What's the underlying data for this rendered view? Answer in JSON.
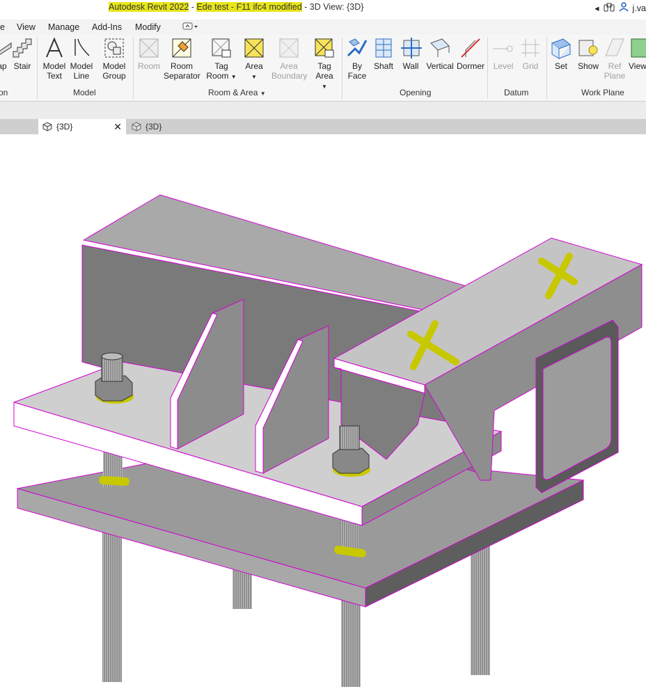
{
  "title": {
    "app": "Autodesk Revit 2022",
    "separator": " - ",
    "project": "Ede test - F11 ifc4 modified",
    "view": " - 3D View: {3D}",
    "user": "j.va"
  },
  "menu": [
    "e",
    "View",
    "Manage",
    "Add-Ins",
    "Modify"
  ],
  "ribbon": {
    "tools": [
      {
        "line1": "ap",
        "line2": "",
        "icon": "ramp-icon",
        "enabled": true
      },
      {
        "line1": "Stair",
        "line2": "",
        "icon": "stair-icon",
        "enabled": true
      },
      {
        "line1": "Model",
        "line2": "Text",
        "icon": "model-text-icon",
        "enabled": true
      },
      {
        "line1": "Model",
        "line2": "Line",
        "icon": "model-line-icon",
        "enabled": true
      },
      {
        "line1": "Model",
        "line2": "Group",
        "icon": "model-group-icon",
        "enabled": true
      },
      {
        "line1": "Room",
        "line2": "",
        "icon": "room-icon",
        "enabled": false
      },
      {
        "line1": "Room",
        "line2": "Separator",
        "icon": "room-separator-icon",
        "enabled": true
      },
      {
        "line1": "Tag",
        "line2": "Room",
        "icon": "tag-room-icon",
        "enabled": true
      },
      {
        "line1": "Area",
        "line2": "",
        "icon": "area-icon",
        "enabled": true
      },
      {
        "line1": "Area",
        "line2": "Boundary",
        "icon": "area-boundary-icon",
        "enabled": false
      },
      {
        "line1": "Tag",
        "line2": "Area",
        "icon": "tag-area-icon",
        "enabled": true
      },
      {
        "line1": "By",
        "line2": "Face",
        "icon": "by-face-icon",
        "enabled": true
      },
      {
        "line1": "Shaft",
        "line2": "",
        "icon": "shaft-icon",
        "enabled": true
      },
      {
        "line1": "Wall",
        "line2": "",
        "icon": "wall-opening-icon",
        "enabled": true
      },
      {
        "line1": "Vertical",
        "line2": "",
        "icon": "vertical-opening-icon",
        "enabled": true
      },
      {
        "line1": "Dormer",
        "line2": "",
        "icon": "dormer-icon",
        "enabled": true
      },
      {
        "line1": "Level",
        "line2": "",
        "icon": "level-icon",
        "enabled": false
      },
      {
        "line1": "Grid",
        "line2": "",
        "icon": "grid-icon",
        "enabled": false
      },
      {
        "line1": "Set",
        "line2": "",
        "icon": "set-icon",
        "enabled": true
      },
      {
        "line1": "Show",
        "line2": "",
        "icon": "show-icon",
        "enabled": true
      },
      {
        "line1": "Ref",
        "line2": "Plane",
        "icon": "ref-plane-icon",
        "enabled": false
      },
      {
        "line1": "View",
        "line2": "",
        "icon": "viewer-icon",
        "enabled": true
      }
    ],
    "panels": [
      "on",
      "Model",
      "Room & Area",
      "Opening",
      "Datum",
      "Work Plane"
    ]
  },
  "tabs": [
    {
      "label": "{3D}",
      "active": true
    },
    {
      "label": "{3D}",
      "active": false
    }
  ],
  "colors": {
    "highlight": "#e8e61a",
    "edge": "#d400d4",
    "markup": "#c8c800",
    "steel_light": "#c9c9c9",
    "steel_mid": "#9a9a9a",
    "steel_dark": "#6e6e6e"
  }
}
